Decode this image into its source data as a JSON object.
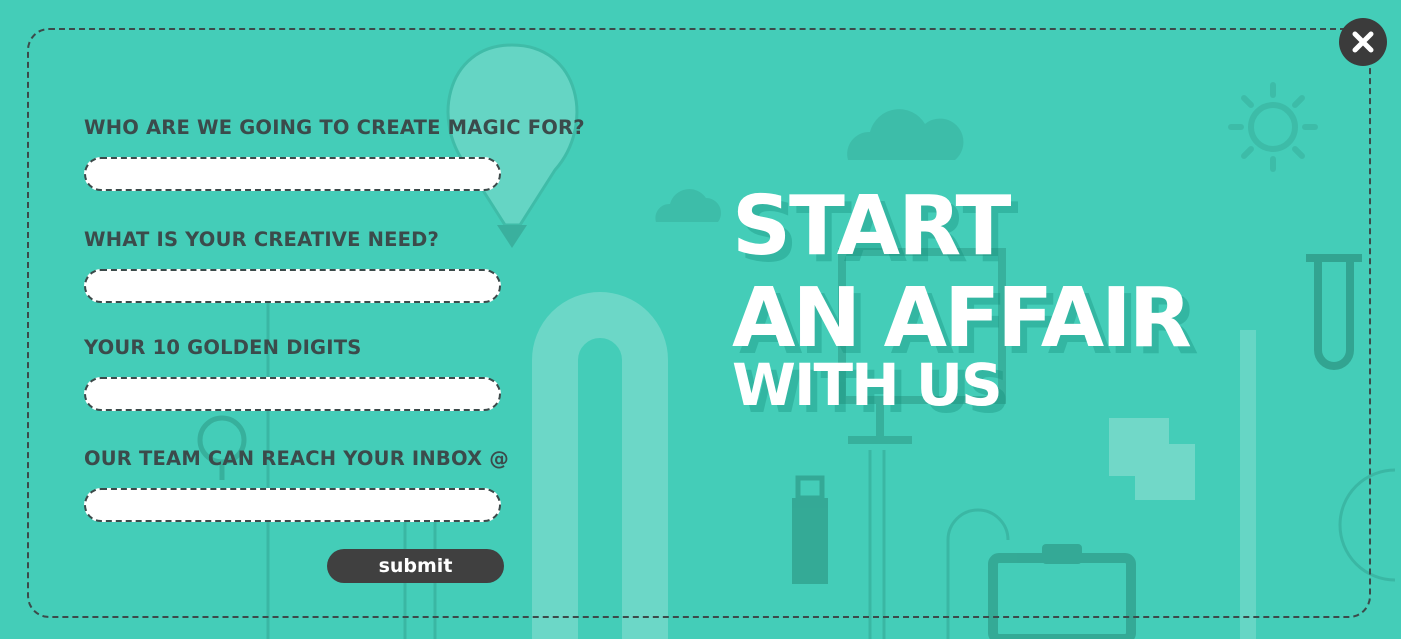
{
  "theme": {
    "background": "#44cdb8",
    "text_dark": "#3b4b4b",
    "button_dark": "#404040",
    "headline_color": "#ffffff"
  },
  "close_button": {
    "icon": "close-icon"
  },
  "form": {
    "fields": [
      {
        "label": "WHO ARE WE GOING TO CREATE MAGIC FOR?",
        "value": "",
        "placeholder": ""
      },
      {
        "label": "WHAT IS YOUR CREATIVE NEED?",
        "value": "",
        "placeholder": ""
      },
      {
        "label": "YOUR 10 GOLDEN DIGITS",
        "value": "",
        "placeholder": ""
      },
      {
        "label": "OUR TEAM CAN REACH YOUR INBOX @",
        "value": "",
        "placeholder": ""
      }
    ],
    "submit_label": "submit"
  },
  "headline": {
    "line1": "START",
    "line2": "AN AFFAIR",
    "line3": "WITH US"
  },
  "background_icons": [
    "balloon-icon",
    "cloud-icon",
    "sun-icon",
    "test-tube-icon",
    "monitor-icon",
    "usb-drive-icon",
    "lightbulb-icon",
    "clipboard-icon",
    "notes-icon",
    "pipe-icon"
  ]
}
